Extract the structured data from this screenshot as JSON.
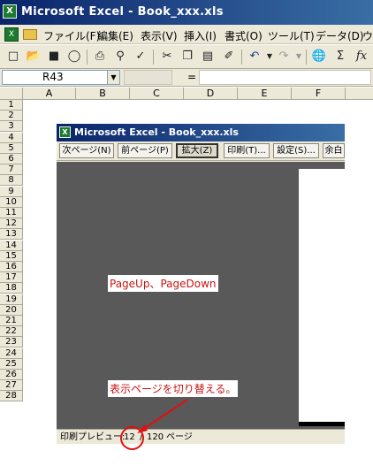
{
  "window": {
    "title": "Microsoft Excel - Book_xxx.xls"
  },
  "menu": [
    "ファイル(F)",
    "編集(E)",
    "表示(V)",
    "挿入(I)",
    "書式(O)",
    "ツール(T)",
    "データ(D)",
    "ウ"
  ],
  "toolbar": {
    "icons": [
      "new-icon",
      "open-icon",
      "save-icon",
      "permission-icon",
      "print-icon",
      "print-preview-icon",
      "spelling-icon",
      "cut-icon",
      "copy-icon",
      "paste-icon",
      "format-painter-icon",
      "undo-icon",
      "redo-icon",
      "hyperlink-icon",
      "autosum-icon",
      "function-icon"
    ],
    "sum_glyph": "Σ",
    "fx_glyph": "fx"
  },
  "formula_bar": {
    "name_box": "R43",
    "equals": "=",
    "value": ""
  },
  "columns": [
    "A",
    "B",
    "C",
    "D",
    "E",
    "F"
  ],
  "rows": [
    "1",
    "2",
    "3",
    "4",
    "5",
    "6",
    "7",
    "8",
    "9",
    "10",
    "11",
    "12",
    "13",
    "14",
    "15",
    "16",
    "17",
    "18",
    "19",
    "20",
    "21",
    "22",
    "23",
    "24",
    "25",
    "26",
    "27",
    "28"
  ],
  "preview": {
    "title": "Microsoft Excel - Book_xxx.xls",
    "buttons": [
      "次ページ(N)",
      "前ページ(P)",
      "拡大(Z)",
      "印刷(T)...",
      "設定(S)...",
      "余白"
    ],
    "status_label": "印刷プレビュー:",
    "current_page": "12",
    "separator": "/",
    "total_pages": "120",
    "page_unit": "ページ"
  },
  "annotations": {
    "callout1": "PageUp、PageDown",
    "callout2": "表示ページを切り替える。",
    "color": "#e01010"
  }
}
